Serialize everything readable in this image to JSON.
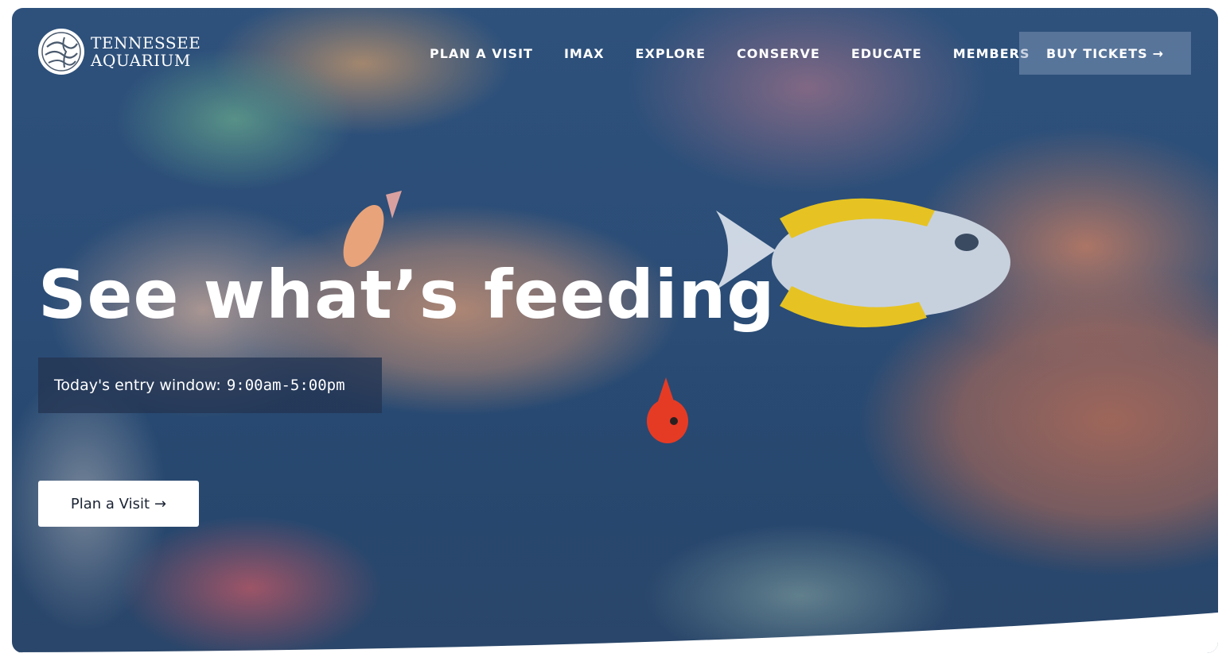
{
  "brand": {
    "name_line1": "TENNESSEE",
    "name_line2": "AQUARIUM"
  },
  "nav": {
    "items": [
      {
        "label": "PLAN A VISIT"
      },
      {
        "label": "IMAX"
      },
      {
        "label": "EXPLORE"
      },
      {
        "label": "CONSERVE"
      },
      {
        "label": "EDUCATE"
      },
      {
        "label": "MEMBERS"
      }
    ],
    "cta_label": "BUY TICKETS",
    "cta_arrow": "→"
  },
  "hero": {
    "headline": "See what’s feeding",
    "entry_label": "Today's entry window:",
    "entry_time": "9:00am-5:00pm",
    "button_label": "Plan a Visit",
    "button_arrow": "→"
  },
  "icons": {
    "logo": "aquarium-logo-icon",
    "arrow": "arrow-right-icon"
  },
  "colors": {
    "text": "#ffffff",
    "button_text": "#1a2333",
    "entry_bg": "#243452"
  }
}
